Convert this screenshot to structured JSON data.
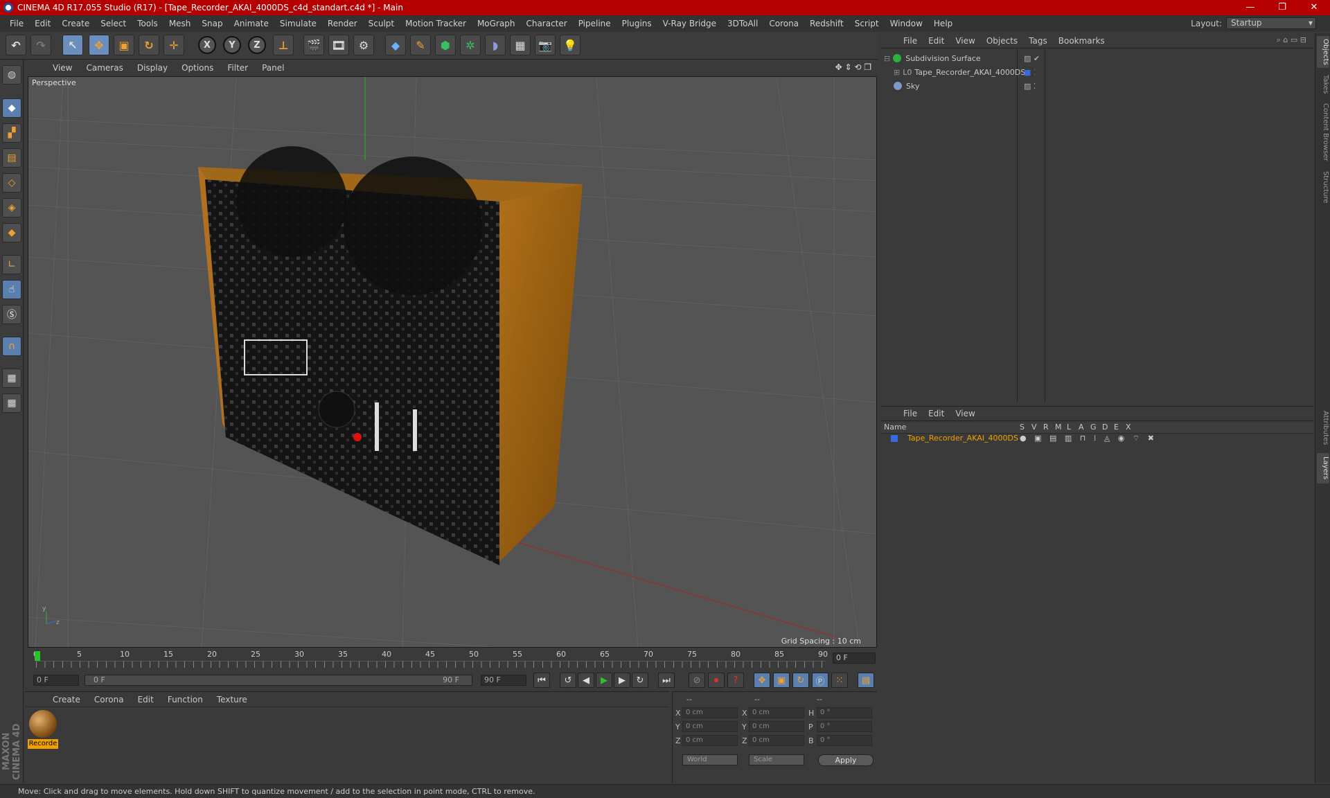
{
  "window": {
    "title": "CINEMA 4D R17.055 Studio (R17) - [Tape_Recorder_AKAI_4000DS_c4d_standart.c4d *] - Main",
    "controls": [
      "—",
      "❐",
      "✕"
    ]
  },
  "menu": [
    "File",
    "Edit",
    "Create",
    "Select",
    "Tools",
    "Mesh",
    "Snap",
    "Animate",
    "Simulate",
    "Render",
    "Sculpt",
    "Motion Tracker",
    "MoGraph",
    "Character",
    "Pipeline",
    "Plugins",
    "V-Ray Bridge",
    "3DToAll",
    "Corona",
    "Redshift",
    "Script",
    "Window",
    "Help"
  ],
  "layout": {
    "label": "Layout:",
    "value": "Startup"
  },
  "toolbar": {
    "undo": "↶",
    "redo": "↷",
    "x": "X",
    "y": "Y",
    "z": "Z"
  },
  "viewport": {
    "menu": [
      "View",
      "Cameras",
      "Display",
      "Options",
      "Filter",
      "Panel"
    ],
    "label": "Perspective",
    "grid_spacing": "Grid Spacing : 10 cm"
  },
  "timeline": {
    "ticks": [
      "0",
      "5",
      "10",
      "15",
      "20",
      "25",
      "30",
      "35",
      "40",
      "45",
      "50",
      "55",
      "60",
      "65",
      "70",
      "75",
      "80",
      "85",
      "90"
    ],
    "current": "0 F",
    "start": "0 F",
    "range_start": "0 F",
    "range_end": "90 F",
    "end": "90 F"
  },
  "materials": {
    "menu": [
      "Create",
      "Corona",
      "Edit",
      "Function",
      "Texture"
    ],
    "item": "Recorde"
  },
  "coords": {
    "col_headers": [
      "--",
      "--",
      "--"
    ],
    "rows": [
      {
        "a": "X",
        "av": "0 cm",
        "b": "X",
        "bv": "0 cm",
        "c": "H",
        "cv": "0 °"
      },
      {
        "a": "Y",
        "av": "0 cm",
        "b": "Y",
        "bv": "0 cm",
        "c": "P",
        "cv": "0 °"
      },
      {
        "a": "Z",
        "av": "0 cm",
        "b": "Z",
        "bv": "0 cm",
        "c": "B",
        "cv": "0 °"
      }
    ],
    "mode": "World",
    "size_mode": "Scale",
    "apply": "Apply"
  },
  "objects": {
    "menu": [
      "File",
      "Edit",
      "View",
      "Objects",
      "Tags",
      "Bookmarks"
    ],
    "items": [
      {
        "name": "Subdivision Surface",
        "color": "#2ab040"
      },
      {
        "name": "Tape_Recorder_AKAI_4000DS",
        "color": "#888888"
      },
      {
        "name": "Sky",
        "color": "#7a9acc"
      }
    ]
  },
  "layers": {
    "menu": [
      "File",
      "Edit",
      "View"
    ],
    "name_col": "Name",
    "flags": [
      "S",
      "V",
      "R",
      "M",
      "L",
      "A",
      "G",
      "D",
      "E",
      "X"
    ],
    "row": "Tape_Recorder_AKAI_4000DS",
    "row_color": "#f0a000"
  },
  "right_tabs": [
    "Objects",
    "Takes",
    "Content Browser",
    "Structure",
    "Attributes",
    "Layers"
  ],
  "brand": "MAXON CINEMA 4D",
  "status": "Move: Click and drag to move elements. Hold down SHIFT to quantize movement / add to the selection in point mode, CTRL to remove."
}
